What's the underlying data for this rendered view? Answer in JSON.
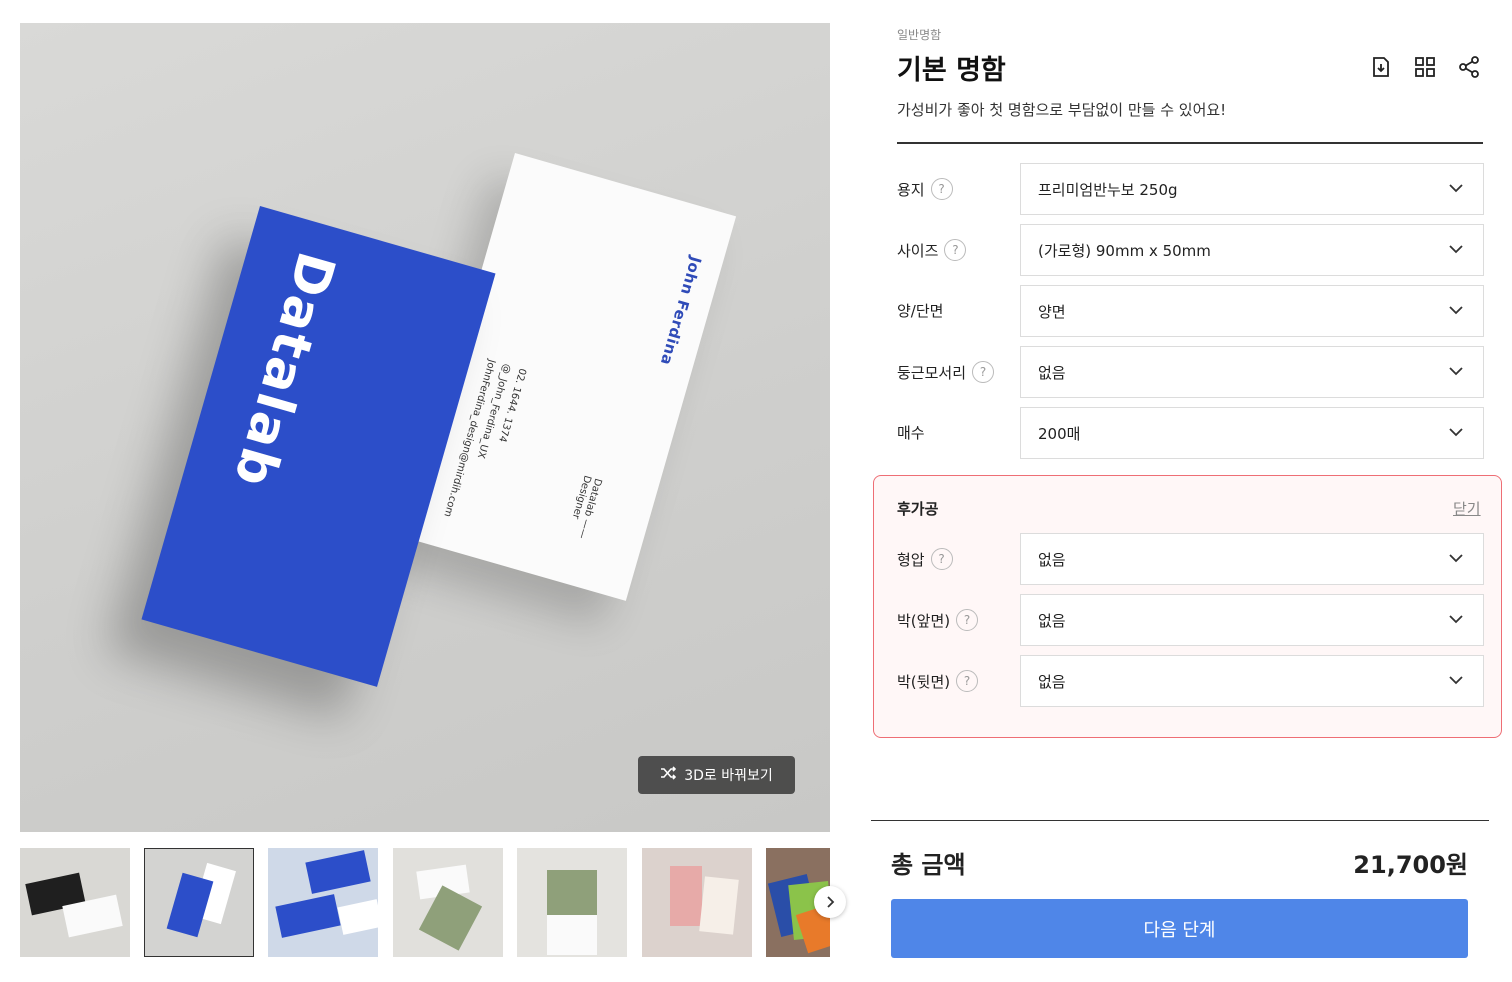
{
  "gallery": {
    "main_card_logo": "Datalab",
    "main_card_name": "John Ferdina",
    "main_card_contact": "02. 1644. 1374\n@_John_Ferdina_UX\nJohnFerdina_design@mirdih.com",
    "main_card_role": "Datalab —— Designer",
    "view_3d_label": "3D로 바꿔보기",
    "thumbnails": [
      "thumb-1",
      "thumb-2",
      "thumb-3",
      "thumb-4",
      "thumb-5",
      "thumb-6",
      "thumb-7"
    ],
    "selected_thumb": 2
  },
  "product": {
    "category": "일반명함",
    "title": "기본 명함",
    "subtitle": "가성비가 좋아 첫 명함으로 부담없이 만들 수 있어요!",
    "icons": [
      "download-icon",
      "grid-icon",
      "share-icon"
    ]
  },
  "options": [
    {
      "label": "용지",
      "help": true,
      "value": "프리미엄반누보 250g"
    },
    {
      "label": "사이즈",
      "help": true,
      "value": "(가로형) 90mm x 50mm"
    },
    {
      "label": "양/단면",
      "help": false,
      "value": "양면"
    },
    {
      "label": "둥근모서리",
      "help": true,
      "value": "없음"
    },
    {
      "label": "매수",
      "help": false,
      "value": "200매"
    }
  ],
  "addon": {
    "title": "후가공",
    "close_label": "닫기",
    "accent_color": "#ee6e75",
    "options": [
      {
        "label": "형압",
        "help": true,
        "value": "없음"
      },
      {
        "label": "박(앞면)",
        "help": true,
        "value": "없음"
      },
      {
        "label": "박(뒷면)",
        "help": true,
        "value": "없음"
      }
    ]
  },
  "summary": {
    "total_label": "총 금액",
    "total_price": "21,700원",
    "next_label": "다음 단계",
    "button_color": "#4f86e8"
  }
}
